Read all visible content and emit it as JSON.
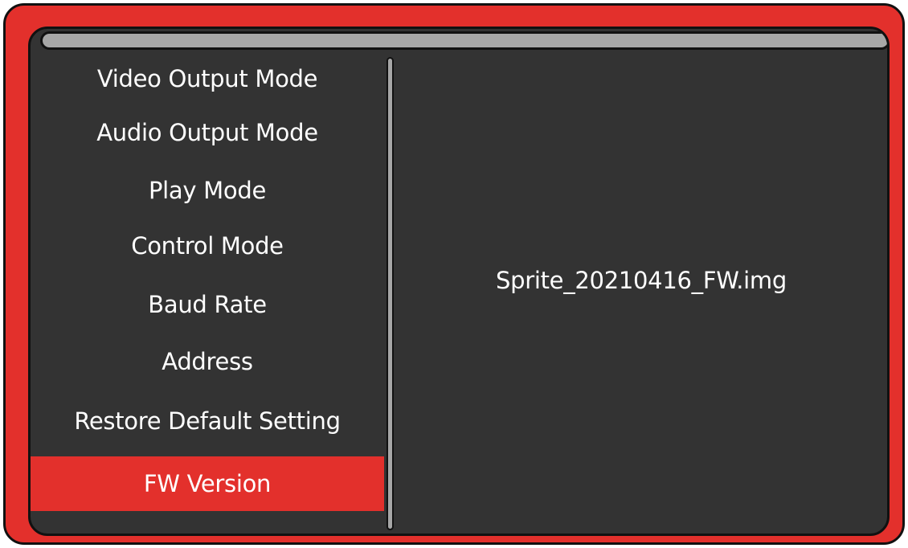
{
  "colors": {
    "frame": "#e3302c",
    "screen": "#333333",
    "title_bar": "#a7a7a7",
    "selected_item": "#e3302c",
    "text": "#ffffff"
  },
  "menu": {
    "items": [
      {
        "label": "Video Output Mode"
      },
      {
        "label": "Audio Output Mode"
      },
      {
        "label": "Play Mode"
      },
      {
        "label": "Control Mode"
      },
      {
        "label": "Baud Rate"
      },
      {
        "label": "Address"
      },
      {
        "label": "Restore Default Setting"
      },
      {
        "label": "FW Version"
      }
    ],
    "selected_label": "FW Version"
  },
  "content": {
    "fw_version_value": "Sprite_20210416_FW.img"
  }
}
